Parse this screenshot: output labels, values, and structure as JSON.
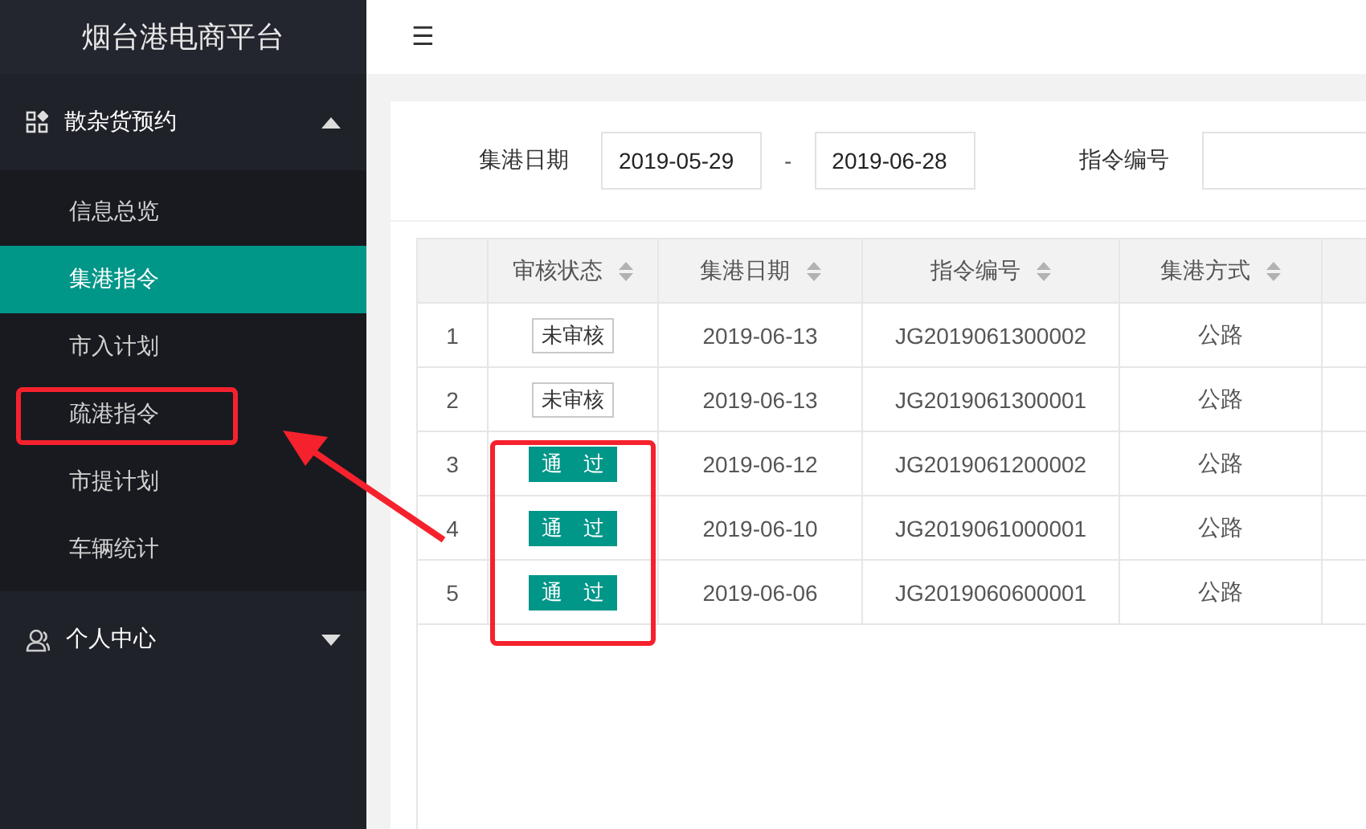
{
  "sidebar": {
    "title": "烟台港电商平台",
    "groups": [
      {
        "label": "散杂货预约",
        "expanded": true,
        "items": [
          {
            "label": "信息总览",
            "selected": false
          },
          {
            "label": "集港指令",
            "selected": true
          },
          {
            "label": "市入计划",
            "selected": false
          },
          {
            "label": "疏港指令",
            "selected": false
          },
          {
            "label": "市提计划",
            "selected": false
          },
          {
            "label": "车辆统计",
            "selected": false
          }
        ]
      },
      {
        "label": "个人中心",
        "expanded": false
      }
    ]
  },
  "toolbar": {
    "menu_icon": "☰"
  },
  "filters": {
    "date_label": "集港日期",
    "date_from": "2019-05-29",
    "separator": "-",
    "date_to": "2019-06-28",
    "order_label": "指令编号"
  },
  "table": {
    "columns": [
      "",
      "审核状态",
      "集港日期",
      "指令编号",
      "集港方式"
    ],
    "rows": [
      {
        "index": "1",
        "status": {
          "kind": "pending",
          "label": "未审核"
        },
        "date": "2019-06-13",
        "order": "JG2019061300002",
        "mode": "公路"
      },
      {
        "index": "2",
        "status": {
          "kind": "pending",
          "label": "未审核"
        },
        "date": "2019-06-13",
        "order": "JG2019061300001",
        "mode": "公路"
      },
      {
        "index": "3",
        "status": {
          "kind": "passed",
          "label": "通　过"
        },
        "date": "2019-06-12",
        "order": "JG2019061200002",
        "mode": "公路"
      },
      {
        "index": "4",
        "status": {
          "kind": "passed",
          "label": "通　过"
        },
        "date": "2019-06-10",
        "order": "JG2019061000001",
        "mode": "公路"
      },
      {
        "index": "5",
        "status": {
          "kind": "passed",
          "label": "通　过"
        },
        "date": "2019-06-06",
        "order": "JG2019060600001",
        "mode": "公路"
      }
    ]
  }
}
